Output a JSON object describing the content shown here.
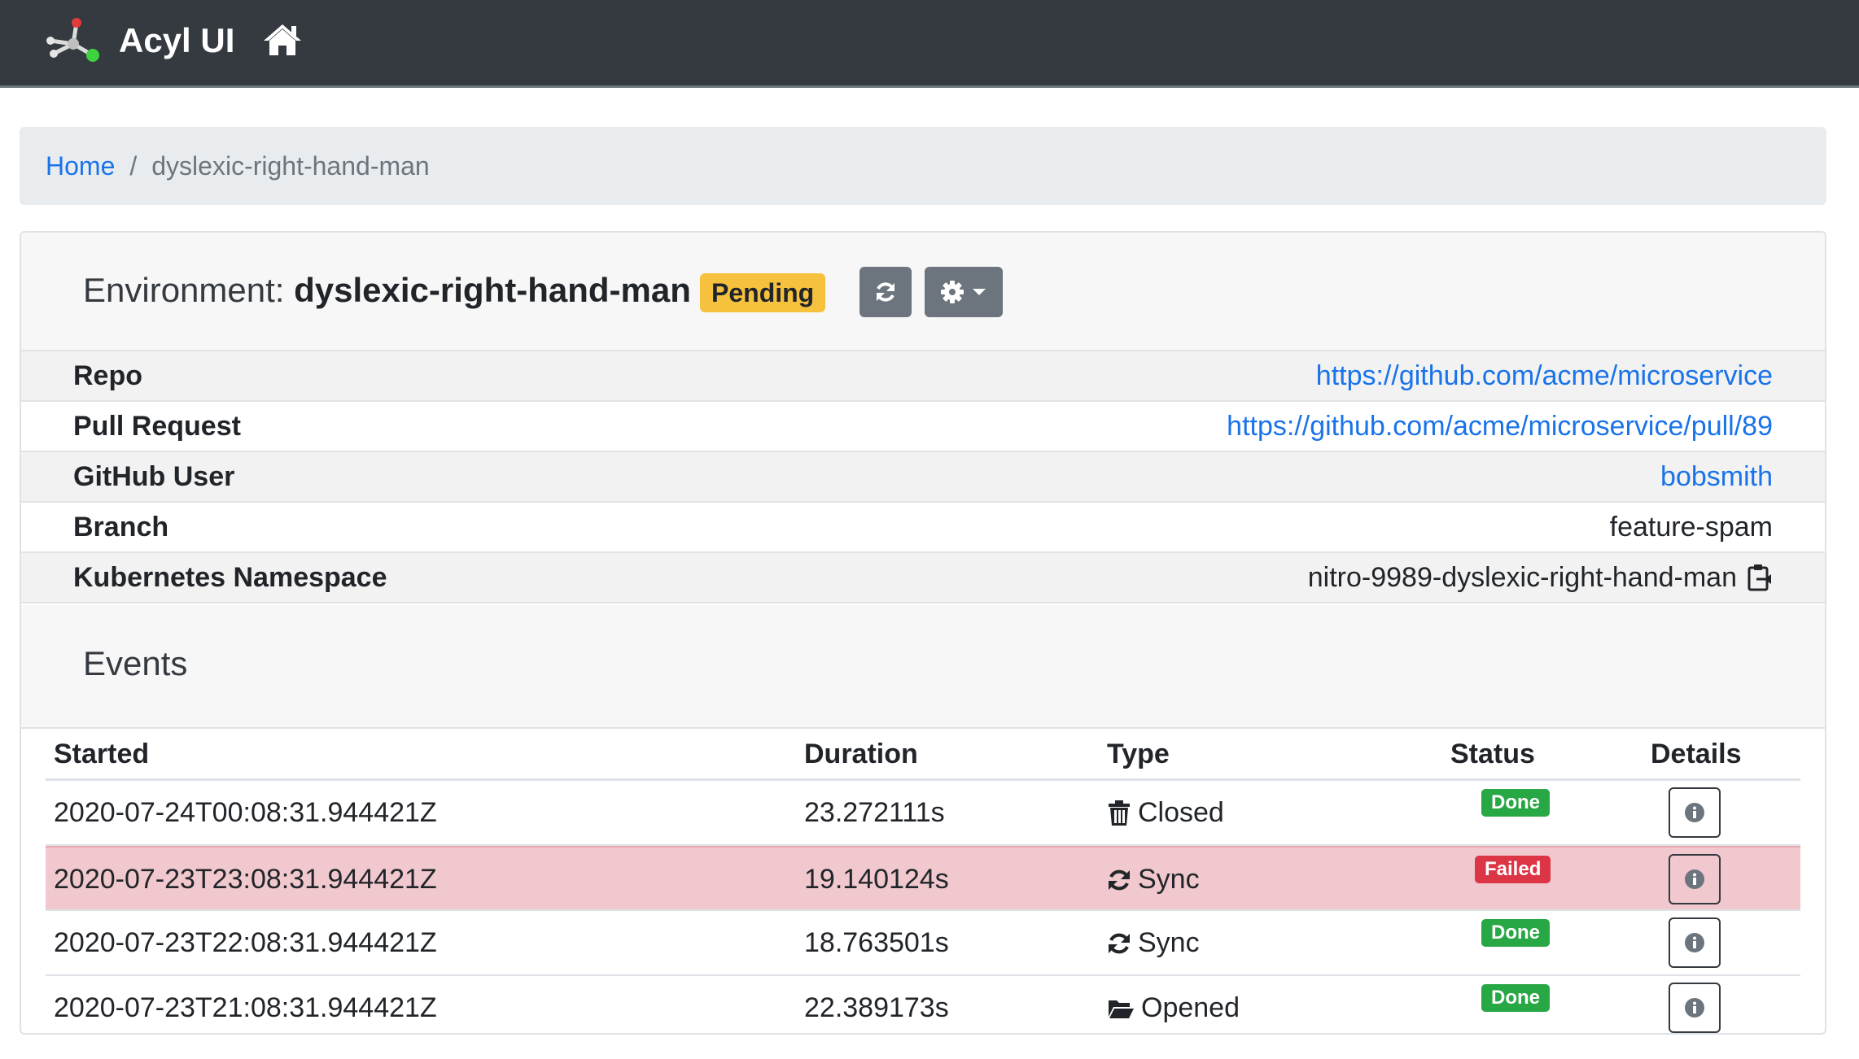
{
  "navbar": {
    "brand": "Acyl UI",
    "home_icon": "home-icon",
    "logo_icon": "molecule-logo-icon"
  },
  "breadcrumb": {
    "home": "Home",
    "separator": "/",
    "current": "dyslexic-right-hand-man"
  },
  "environment": {
    "title_prefix": "Environment:",
    "name": "dyslexic-right-hand-man",
    "status": "Pending",
    "status_color": "#f6c23e",
    "refresh_icon": "refresh-icon",
    "settings_icon": "gear-icon",
    "settings_caret": "caret-down-icon"
  },
  "info": [
    {
      "label": "Repo",
      "value": "https://github.com/acme/microservice",
      "link": true
    },
    {
      "label": "Pull Request",
      "value": "https://github.com/acme/microservice/pull/89",
      "link": true
    },
    {
      "label": "GitHub User",
      "value": "bobsmith",
      "link": true
    },
    {
      "label": "Branch",
      "value": "feature-spam",
      "link": false
    },
    {
      "label": "Kubernetes Namespace",
      "value": "nitro-9989-dyslexic-right-hand-man",
      "link": false,
      "copy_icon": "clipboard-icon"
    }
  ],
  "events": {
    "title": "Events",
    "columns": [
      "Started",
      "Duration",
      "Type",
      "Status",
      "Details"
    ],
    "rows": [
      {
        "started": "2020-07-24T00:08:31.944421Z",
        "duration": "23.272111s",
        "type": "Closed",
        "type_icon": "trash-icon",
        "status": "Done"
      },
      {
        "started": "2020-07-23T23:08:31.944421Z",
        "duration": "19.140124s",
        "type": "Sync",
        "type_icon": "sync-icon",
        "status": "Failed"
      },
      {
        "started": "2020-07-23T22:08:31.944421Z",
        "duration": "18.763501s",
        "type": "Sync",
        "type_icon": "sync-icon",
        "status": "Done"
      },
      {
        "started": "2020-07-23T21:08:31.944421Z",
        "duration": "22.389173s",
        "type": "Opened",
        "type_icon": "folder-open-icon",
        "status": "Done"
      }
    ]
  },
  "colors": {
    "navbar": "#343a40",
    "link": "#1a73e8",
    "done": "#28a745",
    "failed": "#dc3545",
    "failed_row": "#f0c8cd"
  }
}
